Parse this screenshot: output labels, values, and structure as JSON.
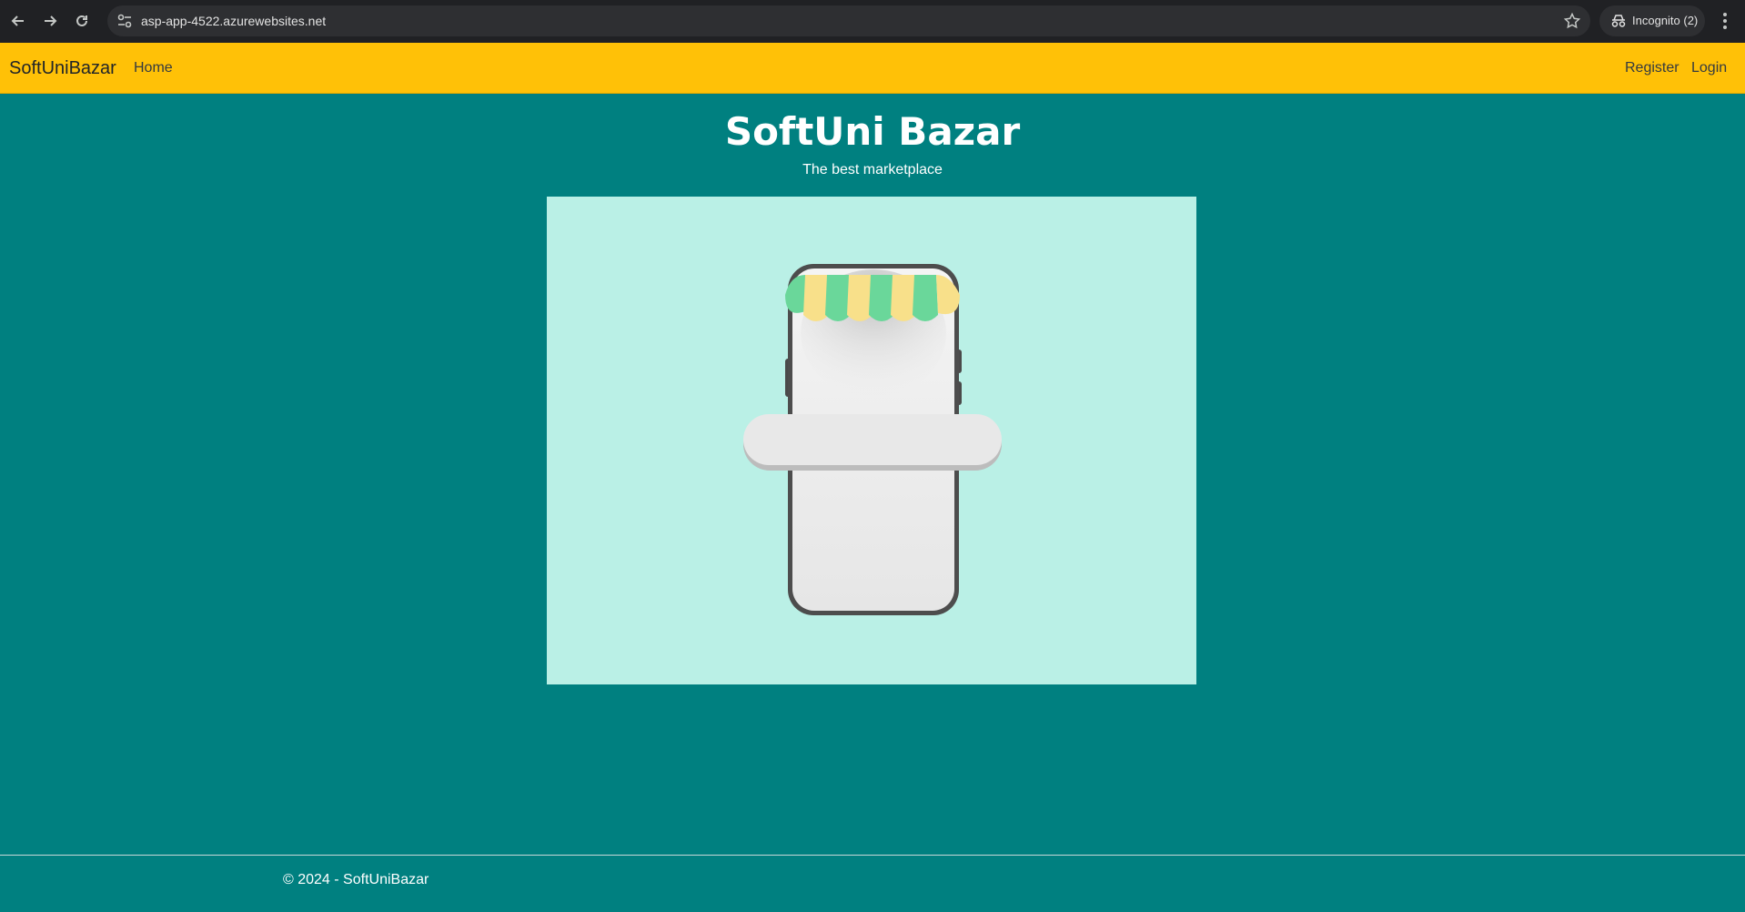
{
  "browser": {
    "url": "asp-app-4522.azurewebsites.net",
    "incognito_label": "Incognito (2)"
  },
  "navbar": {
    "brand": "SoftUniBazar",
    "home_label": "Home",
    "register_label": "Register",
    "login_label": "Login",
    "background": "#ffc107"
  },
  "hero": {
    "title": "SoftUni Bazar",
    "subtitle": "The best marketplace",
    "image_icon": "phone-storefront-illustration",
    "image_background": "#baf0e6"
  },
  "footer": {
    "copyright": "© 2024 - SoftUniBazar"
  },
  "colors": {
    "page_background": "#008080",
    "accent": "#ffc107"
  }
}
